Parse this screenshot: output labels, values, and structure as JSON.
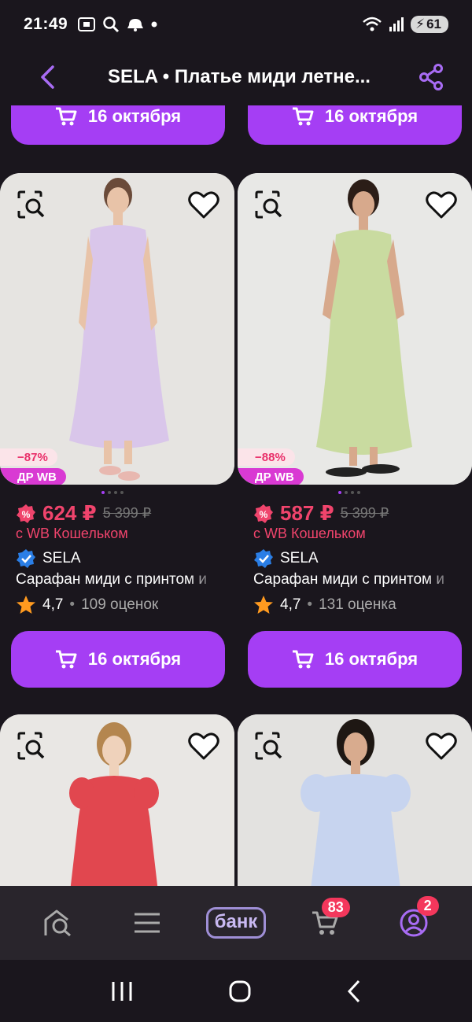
{
  "status": {
    "time": "21:49",
    "battery": "61"
  },
  "header": {
    "title": "SELA • Платье миди летне..."
  },
  "delivery_label": "16 октября",
  "products": [
    {
      "discount": "−87%",
      "promo": "ДР WB",
      "price": "624 ₽",
      "old_price": "5 399 ₽",
      "wallet": "с WB Кошельком",
      "brand": "SELA",
      "name": "Сарафан миди с принтом и",
      "rating": "4,7",
      "reviews": "109 оценок",
      "dress_color": "#d9c6ea"
    },
    {
      "discount": "−88%",
      "promo": "ДР WB",
      "price": "587 ₽",
      "old_price": "5 399 ₽",
      "wallet": "с WB Кошельком",
      "brand": "SELA",
      "name": "Сарафан миди с принтом и",
      "rating": "4,7",
      "reviews": "131 оценка",
      "dress_color": "#c9dba0"
    },
    {
      "dress_color": "#e1474f"
    },
    {
      "dress_color": "#c7d4ef"
    }
  ],
  "bottom_nav": {
    "bank_label": "банк",
    "cart_badge": "83",
    "profile_badge": "2"
  },
  "colors": {
    "accent": "#a53ef4",
    "price": "#f0446c"
  }
}
